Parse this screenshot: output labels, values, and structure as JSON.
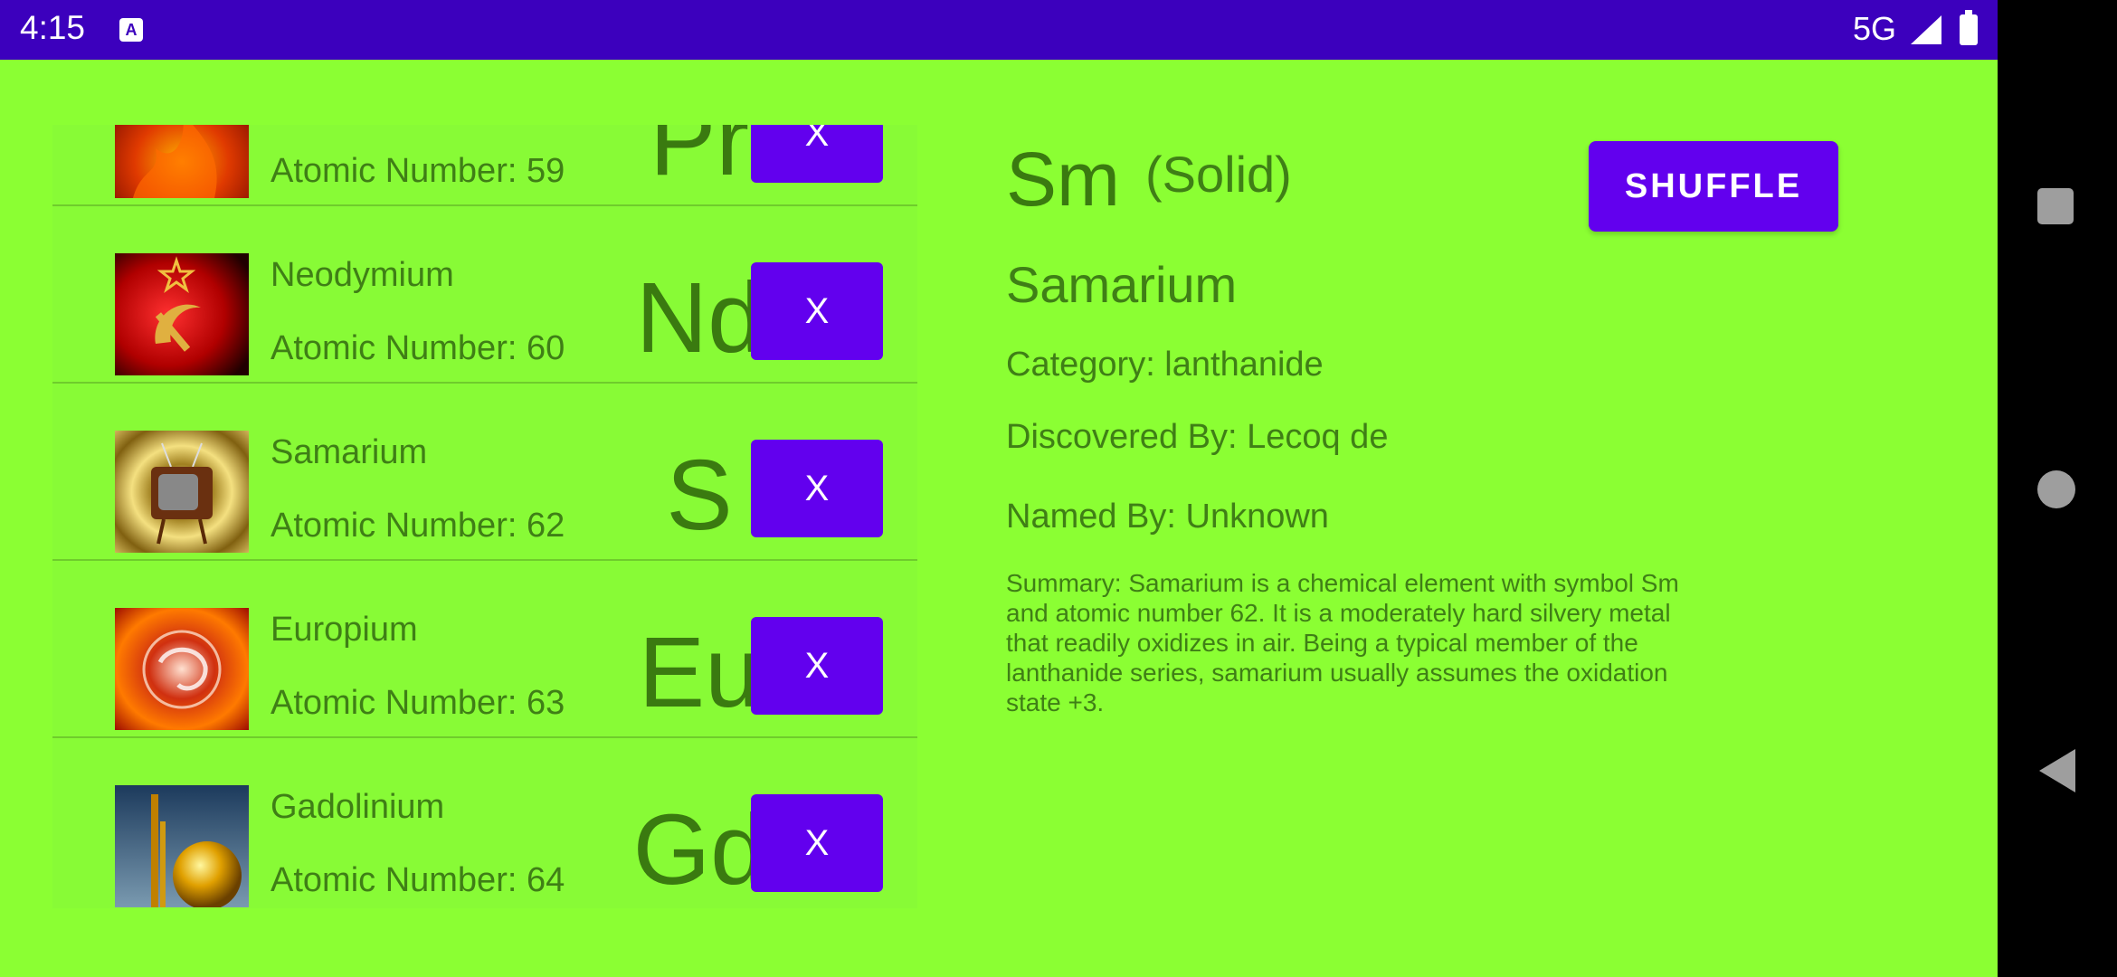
{
  "status_bar": {
    "time": "4:15",
    "network": "5G"
  },
  "elements": [
    {
      "name": "",
      "atomic_number": "Atomic Number: 59",
      "symbol": "Pr",
      "remove_label": "X"
    },
    {
      "name": "Neodymium",
      "atomic_number": "Atomic Number: 60",
      "symbol": "Nd",
      "remove_label": "X"
    },
    {
      "name": "Samarium",
      "atomic_number": "Atomic Number: 62",
      "symbol": "S",
      "remove_label": "X"
    },
    {
      "name": "Europium",
      "atomic_number": "Atomic Number: 63",
      "symbol": "Eu",
      "remove_label": "X"
    },
    {
      "name": "Gadolinium",
      "atomic_number": "Atomic Number: 64",
      "symbol": "Gd",
      "remove_label": "X"
    }
  ],
  "detail": {
    "symbol": "Sm",
    "state": "(Solid)",
    "name": "Samarium",
    "category": "Category: lanthanide",
    "discovered_by": "Discovered By: Lecoq de",
    "named_by": "Named By: Unknown",
    "summary": "Summary: Samarium is a chemical element with symbol Sm and atomic number 62. It is a moderately hard silvery metal that readily oxidizes in air. Being a typical member of the lanthanide series, samarium usually assumes the oxidation state +3."
  },
  "shuffle_label": "SHUFFLE",
  "colors": {
    "background": "#8bff33",
    "accent": "#6200ee",
    "status_bar": "#3c00bd",
    "text": "#3f7f16"
  }
}
